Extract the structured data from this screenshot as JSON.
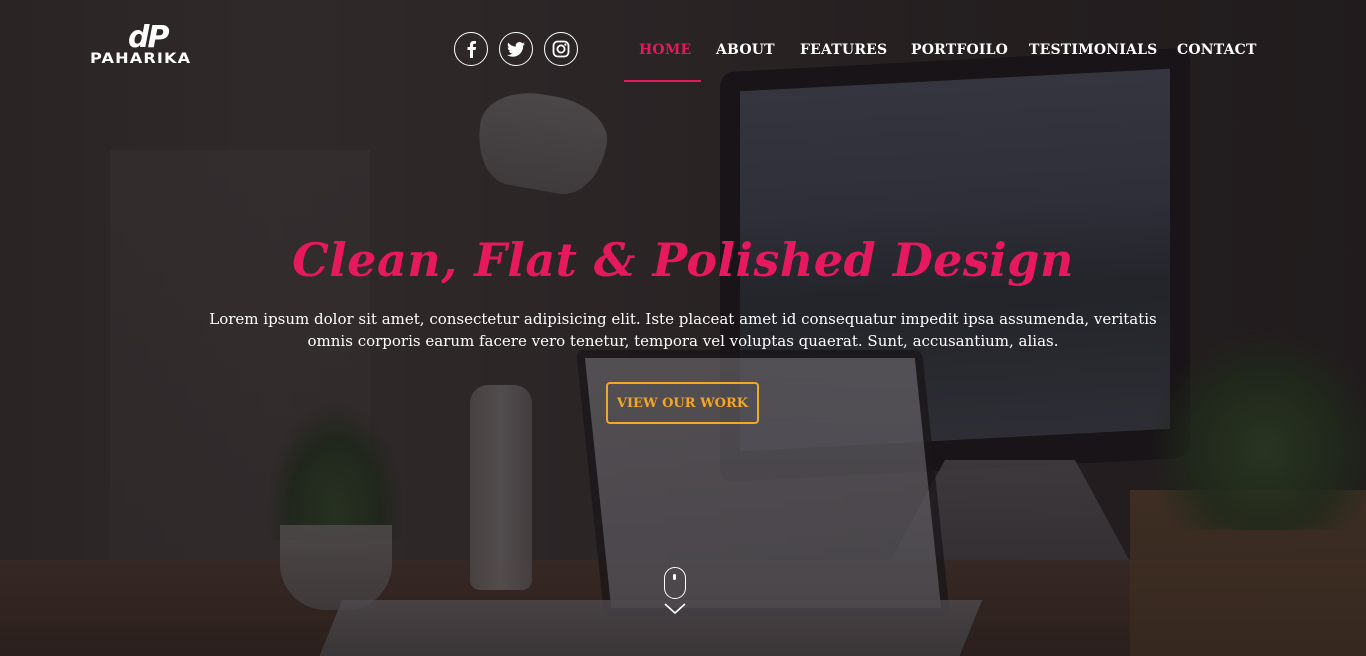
{
  "brand": {
    "mark": "dP",
    "name": "PAHARIKA"
  },
  "social": [
    {
      "name": "facebook",
      "icon": "facebook-icon"
    },
    {
      "name": "twitter",
      "icon": "twitter-icon"
    },
    {
      "name": "instagram",
      "icon": "instagram-icon"
    }
  ],
  "nav": {
    "items": [
      "HOME",
      "ABOUT",
      "FEATURES",
      "PORTFOILO",
      "TESTIMONIALS",
      "CONTACT"
    ],
    "active": "HOME"
  },
  "hero": {
    "title": "Clean, Flat & Polished Design",
    "text_line1": "Lorem ipsum dolor sit amet, consectetur adipisicing elit. Iste placeat amet id consequatur impedit ipsa assumenda, veritatis",
    "text_line2": "omnis corporis earum facere vero tenetur, tempora vel voluptas quaerat. Sunt, accusantium, alias.",
    "cta_label": "VIEW OUR WORK"
  },
  "scroll_indicator": {
    "icon": "mouse-scroll-icon",
    "arrow_icon": "chevron-down-icon"
  },
  "colors": {
    "accent": "#e6195e",
    "button": "#f5a623",
    "text": "#ffffff"
  }
}
